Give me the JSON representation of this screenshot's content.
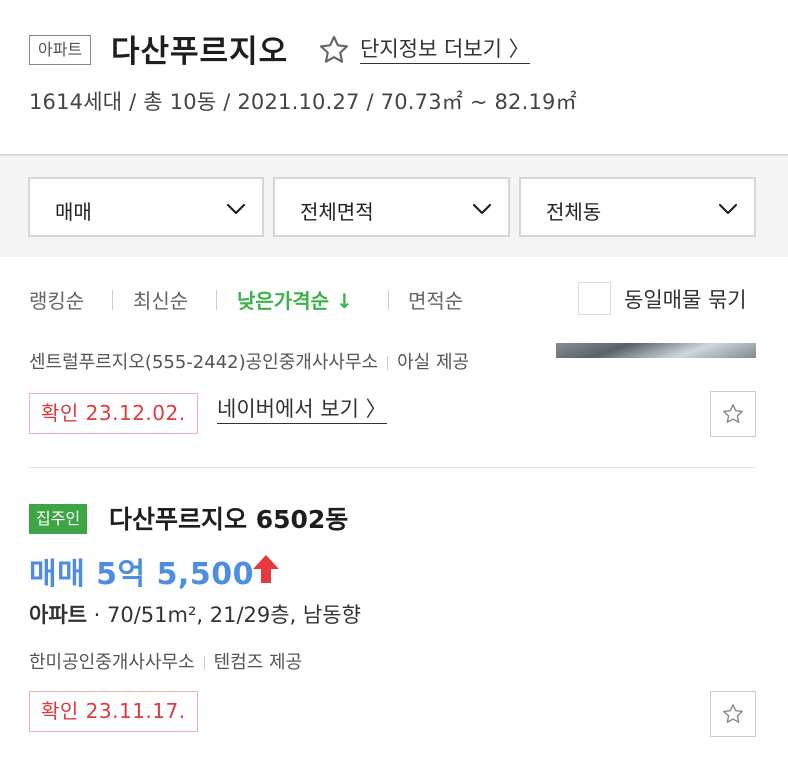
{
  "complex": {
    "type_badge": "아파트",
    "name": "다산푸르지오",
    "more_link": "단지정보 더보기 〉",
    "summary": "1614세대 / 총 10동 / 2021.10.27 / 70.73㎡ ~ 82.19㎡"
  },
  "filters": [
    {
      "label": "매매"
    },
    {
      "label": "전체면적"
    },
    {
      "label": "전체동"
    }
  ],
  "sort": {
    "options": [
      "랭킹순",
      "최신순",
      "낮은가격순 ↓",
      "면적순"
    ],
    "active_index": 2,
    "group_checkbox_label": "동일매물 묶기",
    "group_checked": false
  },
  "listings": [
    {
      "agency": "센트럴푸르지오(555-2442)공인중개사사무소",
      "provider": "아실 제공",
      "confirmed": "확인 23.12.02.",
      "naver_link": "네이버에서 보기 〉"
    },
    {
      "owner_badge": "집주인",
      "title": "다산푸르지오 6502동",
      "price": "매매 5억 5,500",
      "kind": "아파트",
      "detail": " · 70/51m², 21/29층, 남동향",
      "agency": "한미공인중개사사무소",
      "provider": "텐컴즈 제공",
      "confirmed": "확인 23.11.17."
    }
  ],
  "colors": {
    "accent_green": "#3cb34a",
    "price_blue": "#4d8ee0",
    "confirm_red": "#e0393e",
    "price_up_red": "#e8393f"
  }
}
